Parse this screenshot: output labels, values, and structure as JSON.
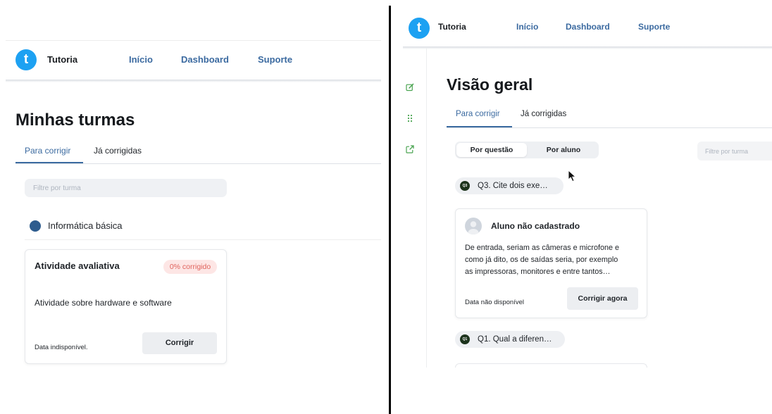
{
  "colors": {
    "accent": "#3b6aa0",
    "logo": "#1da1f2",
    "badge_text": "#e0625c",
    "badge_bg": "#fde6e5",
    "sidebar_icon": "#4aa451",
    "class_dot": "#2e5c8e",
    "question_dot": "#1d341d"
  },
  "left": {
    "header": {
      "logo_icon": "tutoria-logo-icon",
      "logo_text": "t",
      "brand": "Tutoria",
      "nav": [
        {
          "label": "Início"
        },
        {
          "label": "Dashboard"
        },
        {
          "label": "Suporte"
        }
      ]
    },
    "page_title": "Minhas turmas",
    "tabs": [
      {
        "label": "Para corrigir",
        "active": true
      },
      {
        "label": "Já corrigidas",
        "active": false
      }
    ],
    "filter": {
      "placeholder": "Filtre por turma"
    },
    "class_group": {
      "icon": "class-badge-icon",
      "name": "Informática básica"
    },
    "activity_card": {
      "title": "Atividade avaliativa",
      "status_badge": "0% corrigido",
      "description": "Atividade sobre hardware e software",
      "date": "Data indisponível.",
      "action_label": "Corrigir"
    }
  },
  "right": {
    "header": {
      "logo_icon": "tutoria-logo-icon",
      "logo_text": "t",
      "brand": "Tutoria",
      "nav": [
        {
          "label": "Início"
        },
        {
          "label": "Dashboard"
        },
        {
          "label": "Suporte"
        }
      ]
    },
    "sidebar": {
      "items": [
        {
          "icon": "edit-icon"
        },
        {
          "icon": "grid-icon"
        },
        {
          "icon": "external-link-icon"
        }
      ]
    },
    "page_title": "Visão geral",
    "tabs": [
      {
        "label": "Para corrigir",
        "active": true
      },
      {
        "label": "Já corrigidas",
        "active": false
      }
    ],
    "view_toggle": {
      "options": [
        {
          "label": "Por questão",
          "selected": true
        },
        {
          "label": "Por aluno",
          "selected": false
        }
      ]
    },
    "filter": {
      "placeholder": "Filtre por turma"
    },
    "questions": [
      {
        "number": "Q3",
        "label": "Q3. Cite dois exe…"
      },
      {
        "number": "Q1",
        "label": "Q1. Qual a diferen…"
      }
    ],
    "answer_card": {
      "avatar_icon": "user-avatar-icon",
      "student": "Aluno não cadastrado",
      "answer_lines": [
        "De entrada, seriam as câmeras e microfone e",
        "como já dito, os de saídas seria, por exemplo",
        "as impressoras, monitores e entre tantos…"
      ],
      "date": "Data não disponível",
      "action_label": "Corrigir agora"
    },
    "cursor_icon": "mouse-pointer-icon"
  }
}
